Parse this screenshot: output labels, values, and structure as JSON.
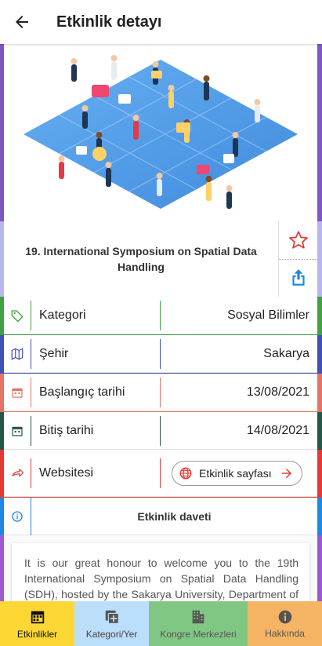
{
  "appbar": {
    "title": "Etkinlik detayı"
  },
  "event": {
    "title": "19. International Symposium on Spatial Data Handling"
  },
  "rows": [
    {
      "label": "Kategori",
      "value": "Sosyal Bilimler",
      "color": "#43a047",
      "icon": "tag-icon"
    },
    {
      "label": "Şehir",
      "value": "Sakarya",
      "color": "#3f51b5",
      "icon": "map-icon"
    },
    {
      "label": "Başlangıç tarihi",
      "value": "13/08/2021",
      "color": "#e57368",
      "icon": "calendar-icon"
    },
    {
      "label": "Bitiş tarihi",
      "value": "14/08/2021",
      "color": "#26574b",
      "icon": "calendar-icon"
    }
  ],
  "website": {
    "label": "Websitesi",
    "button": "Etkinlik sayfası",
    "color": "#e53935"
  },
  "invite": {
    "title": "Etkinlik daveti",
    "color": "#1e88e5"
  },
  "description": "It is our great honour to welcome you to the 19th International Symposium on Spatial Data Handling (SDH), hosted by the Sakarya University, Department of Geography...",
  "nav": [
    {
      "label": "Etkinlikler",
      "bg": "#fdd835",
      "fg": "#111111",
      "icon": "calendar-icon"
    },
    {
      "label": "Kategori/Yer",
      "bg": "#bbdefb",
      "fg": "#444444",
      "icon": "add-box-icon"
    },
    {
      "label": "Kongre Merkezleri",
      "bg": "#81c784",
      "fg": "#555555",
      "icon": "building-icon"
    },
    {
      "label": "Hakkında",
      "bg": "#f4b464",
      "fg": "#555555",
      "icon": "info-icon"
    }
  ]
}
